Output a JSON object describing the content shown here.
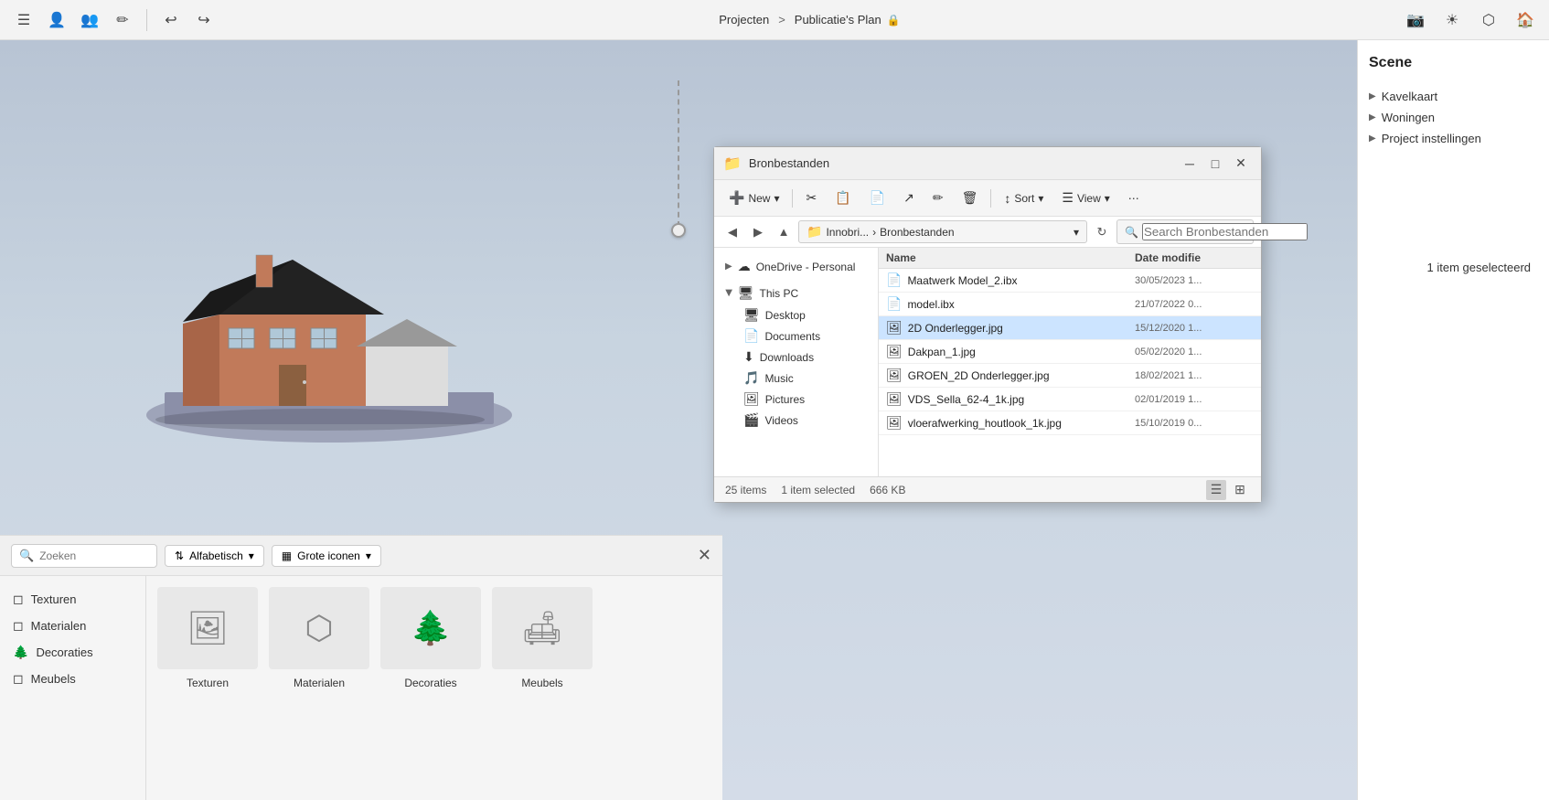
{
  "app": {
    "title": "Publicatie's Plan",
    "breadcrumb1": "Projecten",
    "breadcrumb_sep": ">",
    "breadcrumb2": "Publicatie's Plan"
  },
  "top_bar": {
    "icons_left": [
      "menu",
      "user",
      "users",
      "edit"
    ],
    "icons_undo": [
      "undo",
      "redo"
    ],
    "icons_right": [
      "camera",
      "sun",
      "layers",
      "home"
    ]
  },
  "scene": {
    "title": "Scene",
    "items": [
      {
        "id": "kavelkaart",
        "label": "Kavelkaart"
      },
      {
        "id": "woningen",
        "label": "Woningen"
      },
      {
        "id": "project-instellingen",
        "label": "Project instellingen"
      }
    ]
  },
  "file_explorer": {
    "title": "Bronbestanden",
    "title_icon": "📁",
    "toolbar": {
      "new_label": "New",
      "sort_label": "Sort",
      "view_label": "View"
    },
    "addressbar": {
      "path_parts": [
        "Innobri...",
        "Bronbestanden"
      ],
      "search_placeholder": "Search Bronbestanden"
    },
    "sidebar": {
      "items": [
        {
          "label": "OneDrive - Personal",
          "icon": "☁",
          "expanded": false
        },
        {
          "label": "This PC",
          "icon": "🖥",
          "expanded": true,
          "children": [
            {
              "label": "Desktop",
              "icon": "🖥"
            },
            {
              "label": "Documents",
              "icon": "📄"
            },
            {
              "label": "Downloads",
              "icon": "⬇"
            },
            {
              "label": "Music",
              "icon": "🎵"
            },
            {
              "label": "Pictures",
              "icon": "🖼"
            },
            {
              "label": "Videos",
              "icon": "🎬"
            }
          ]
        }
      ]
    },
    "columns": [
      {
        "id": "name",
        "label": "Name"
      },
      {
        "id": "date",
        "label": "Date modifie"
      }
    ],
    "files": [
      {
        "name": "Maatwerk Model_2.ibx",
        "date": "30/05/2023 1...",
        "icon": "📄",
        "selected": false
      },
      {
        "name": "model.ibx",
        "date": "21/07/2022 0...",
        "icon": "📄",
        "selected": false
      },
      {
        "name": "2D Onderlegger.jpg",
        "date": "15/12/2020 1...",
        "icon": "🖼",
        "selected": true
      },
      {
        "name": "Dakpan_1.jpg",
        "date": "05/02/2020 1...",
        "icon": "🖼",
        "selected": false
      },
      {
        "name": "GROEN_2D Onderlegger.jpg",
        "date": "18/02/2021 1...",
        "icon": "🖼",
        "selected": false
      },
      {
        "name": "VDS_Sella_62-4_1k.jpg",
        "date": "02/01/2019 1...",
        "icon": "🖼",
        "selected": false
      },
      {
        "name": "vloerafwerking_houtlook_1k.jpg",
        "date": "15/10/2019 0...",
        "icon": "🖼",
        "selected": false
      }
    ],
    "statusbar": {
      "item_count": "25 items",
      "selected_text": "1 item selected",
      "file_size": "666 KB"
    }
  },
  "selected_tooltip": "1 item geselecteerd",
  "bottom_panel": {
    "search_placeholder": "Zoeken",
    "sort_label": "Alfabetisch",
    "view_label": "Grote iconen",
    "nav_items": [
      {
        "id": "texturen",
        "label": "Texturen",
        "icon": "◻"
      },
      {
        "id": "materialen",
        "label": "Materialen",
        "icon": "◻"
      },
      {
        "id": "decoraties",
        "label": "Decoraties",
        "icon": "🌲"
      },
      {
        "id": "meubels",
        "label": "Meubels",
        "icon": "◻"
      }
    ],
    "grid_items": [
      {
        "id": "texturen-grid",
        "label": "Texturen",
        "icon": "🖼"
      },
      {
        "id": "materialen-grid",
        "label": "Materialen",
        "icon": "⬡"
      },
      {
        "id": "decoraties-grid",
        "label": "Decoraties",
        "icon": "🌲"
      },
      {
        "id": "meubels-grid",
        "label": "Meubels",
        "icon": "🛋"
      }
    ]
  }
}
